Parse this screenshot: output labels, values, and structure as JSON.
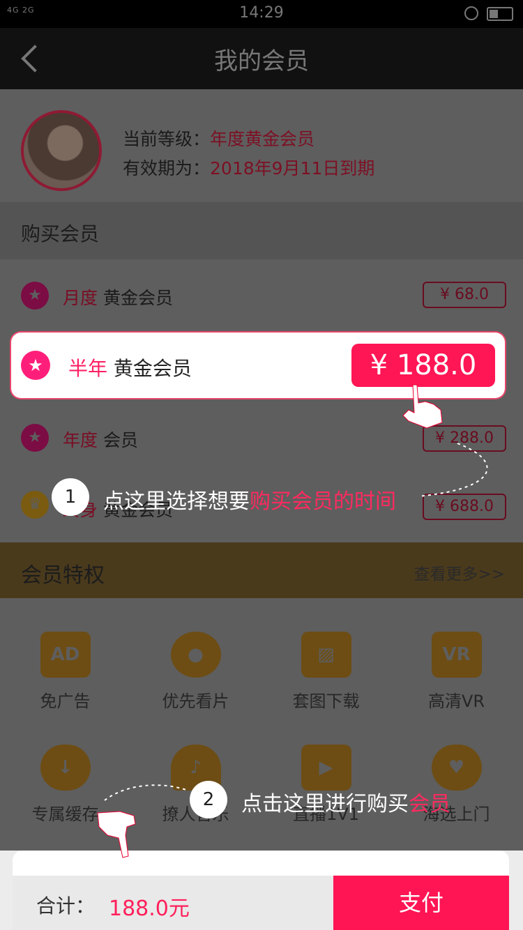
{
  "status_bar": {
    "signal": "4G 2G",
    "time": "14:29"
  },
  "nav": {
    "title": "我的会员"
  },
  "profile": {
    "level_label": "当前等级：",
    "level_value": "年度黄金会员",
    "expiry_label": "有效期为：",
    "expiry_value": "2018年9月11日到期"
  },
  "buy_section": {
    "title": "购买会员"
  },
  "plans": [
    {
      "term": "月度",
      "name": "黄金会员",
      "price": "¥ 68.0"
    },
    {
      "term": "半年",
      "name": "黄金会员",
      "price": "¥ 188.0"
    },
    {
      "term": "年度",
      "name": "会员",
      "price": "¥ 288.0"
    },
    {
      "term": "终身",
      "name": "黄金会员",
      "price": "¥ 688.0"
    }
  ],
  "privileges": {
    "title": "会员特权",
    "more": "查看更多>>",
    "items": [
      {
        "label": "免广告",
        "icon": "ad-icon"
      },
      {
        "label": "优先看片",
        "icon": "film-reel-icon"
      },
      {
        "label": "套图下载",
        "icon": "picture-icon"
      },
      {
        "label": "高清VR",
        "icon": "vr-camera-icon"
      },
      {
        "label": "专属缓存",
        "icon": "cloud-download-icon"
      },
      {
        "label": "撩人音乐",
        "icon": "headphones-icon"
      },
      {
        "label": "直播1V1",
        "icon": "live-video-icon"
      },
      {
        "label": "海选上门",
        "icon": "heart-chat-icon"
      }
    ]
  },
  "bottom": {
    "total_label": "合计：",
    "total_value": "188.0元",
    "pay_label": "支付"
  },
  "guide": {
    "step1_num": "1",
    "step1_text": "点这里选择想要",
    "step1_hl": "购买会员的时间",
    "step2_num": "2",
    "step2_text": "点击这里进行购买",
    "step2_hl": "会员"
  },
  "colors": {
    "accent": "#ff1655",
    "highlight_text": "#ff1f63",
    "dim_overlay": "#5e5e5e",
    "gold": "#7a5b10"
  }
}
